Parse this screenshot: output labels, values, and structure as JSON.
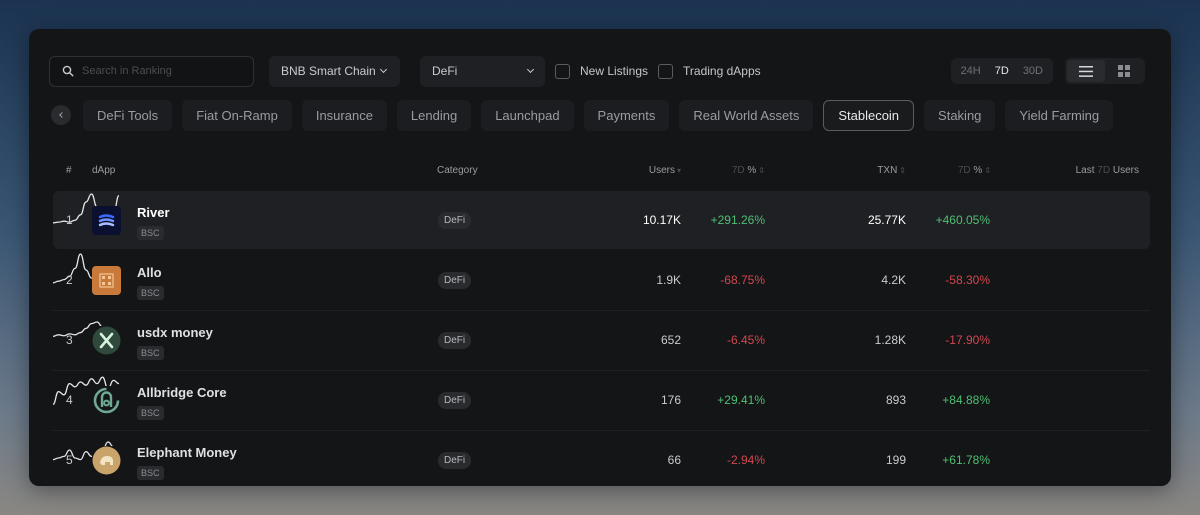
{
  "toolbar": {
    "search_placeholder": "Search in Ranking",
    "chain": "BNB Smart Chain",
    "category": "DeFi",
    "checkboxes": [
      "New Listings",
      "Trading dApps"
    ],
    "time_ranges": [
      "24H",
      "7D",
      "30D"
    ],
    "active_time_range": "7D",
    "views": [
      "list-view-icon",
      "grid-view-icon"
    ]
  },
  "tabs": [
    "DeFi Tools",
    "Fiat On-Ramp",
    "Insurance",
    "Lending",
    "Launchpad",
    "Payments",
    "Real World Assets",
    "Stablecoin",
    "Staking",
    "Yield Farming"
  ],
  "active_tab": "Stablecoin",
  "table": {
    "headers": {
      "rank": "#",
      "dapp": "dApp",
      "category": "Category",
      "users": "Users",
      "users_change_prefix": "7D",
      "users_change_suffix": "%",
      "txn": "TXN",
      "txn_change_prefix": "7D",
      "txn_change_suffix": "%",
      "spark_prefix": "Last",
      "spark_mid": "7D",
      "spark_suffix": "Users"
    },
    "rows": [
      {
        "rank": "1",
        "name": "River",
        "chain": "BSC",
        "category": "DeFi",
        "users": "10.17K",
        "users_change": "+291.26%",
        "txn": "25.77K",
        "txn_change": "+460.05%",
        "spark": [
          0.1,
          0.12,
          0.15,
          0.12,
          0.18,
          0.35,
          0.75,
          1.0,
          0.6,
          0.05,
          0.1,
          0.4,
          0.95
        ]
      },
      {
        "rank": "2",
        "name": "Allo",
        "chain": "BSC",
        "category": "DeFi",
        "users": "1.9K",
        "users_change": "-68.75%",
        "txn": "4.2K",
        "txn_change": "-58.30%",
        "spark": [
          0.1,
          0.15,
          0.2,
          0.3,
          0.55,
          1.0,
          0.5,
          0.25,
          0.15,
          0.12,
          0.1,
          0.1,
          0.08
        ]
      },
      {
        "rank": "3",
        "name": "usdx money",
        "chain": "BSC",
        "category": "DeFi",
        "users": "652",
        "users_change": "-6.45%",
        "txn": "1.28K",
        "txn_change": "-17.90%",
        "spark": [
          0.3,
          0.35,
          0.32,
          0.38,
          0.35,
          0.42,
          0.55,
          0.7,
          0.75,
          0.6,
          0.45,
          0.35,
          0.3
        ]
      },
      {
        "rank": "4",
        "name": "Allbridge Core",
        "chain": "BSC",
        "category": "DeFi",
        "users": "176",
        "users_change": "+29.41%",
        "txn": "893",
        "txn_change": "+84.88%",
        "spark": [
          0.05,
          0.45,
          0.35,
          0.7,
          0.6,
          0.75,
          0.65,
          0.85,
          0.7,
          0.9,
          0.55,
          0.8,
          0.7
        ]
      },
      {
        "rank": "5",
        "name": "Elephant Money",
        "chain": "BSC",
        "category": "DeFi",
        "users": "66",
        "users_change": "-2.94%",
        "txn": "199",
        "txn_change": "+61.78%",
        "spark": [
          0.2,
          0.25,
          0.3,
          0.5,
          0.25,
          0.2,
          0.45,
          0.3,
          0.55,
          0.5,
          0.75,
          0.6,
          0.45
        ]
      }
    ]
  },
  "colors": {
    "positive": "#4fbf73",
    "negative": "#d0484f",
    "spark": "#e6e6e8",
    "accent_river": "#3b6bff"
  }
}
